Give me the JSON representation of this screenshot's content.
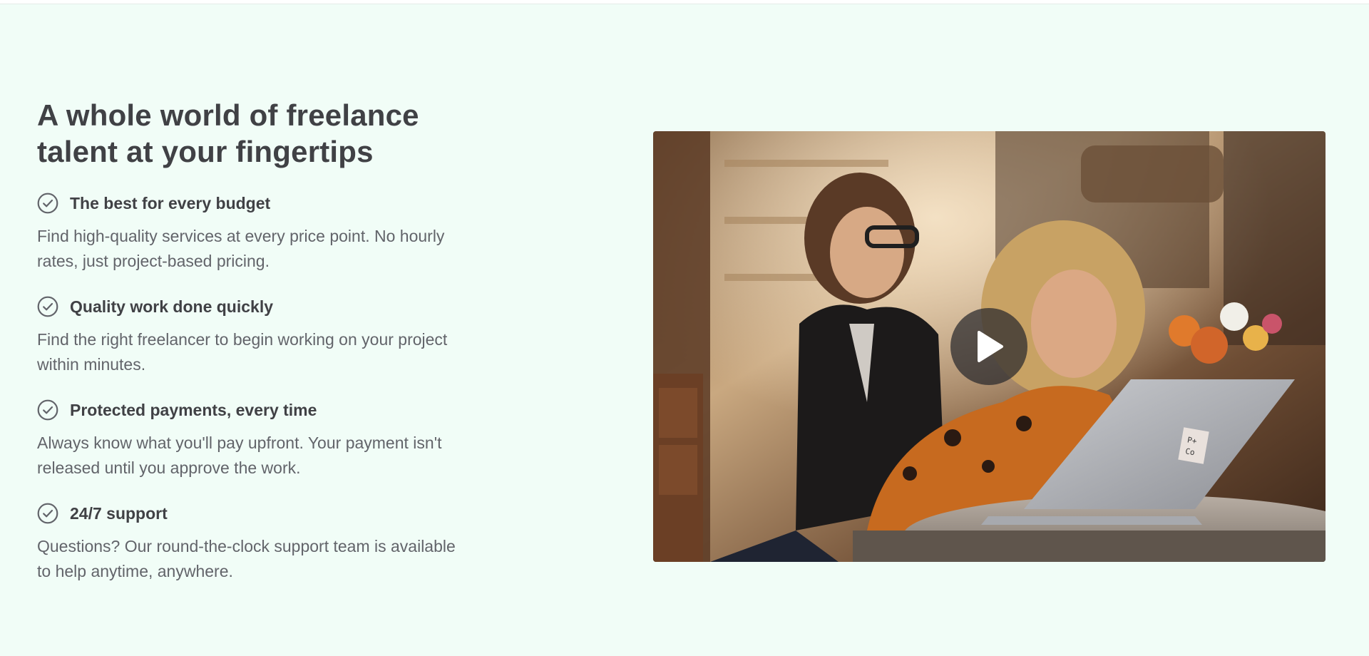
{
  "hero": {
    "headline": "A whole world of freelance talent at your fingertips"
  },
  "features": [
    {
      "title": "The best for every budget",
      "description": "Find high-quality services at every price point. No hourly rates, just project-based pricing."
    },
    {
      "title": "Quality work done quickly",
      "description": "Find the right freelancer to begin working on your project within minutes."
    },
    {
      "title": "Protected payments, every time",
      "description": "Always know what you'll pay upfront. Your payment isn't released until you approve the work."
    },
    {
      "title": "24/7 support",
      "description": "Questions? Our round-the-clock support team is available to help anytime, anywhere."
    }
  ],
  "video": {
    "laptop_logo": [
      "P+",
      "Co"
    ]
  },
  "colors": {
    "background": "#f1fdf7",
    "heading": "#404145",
    "body_text": "#62646a",
    "check_icon": "#62646a"
  },
  "icons": {
    "feature_icon": "check-circle-icon",
    "video_icon": "play-icon"
  }
}
